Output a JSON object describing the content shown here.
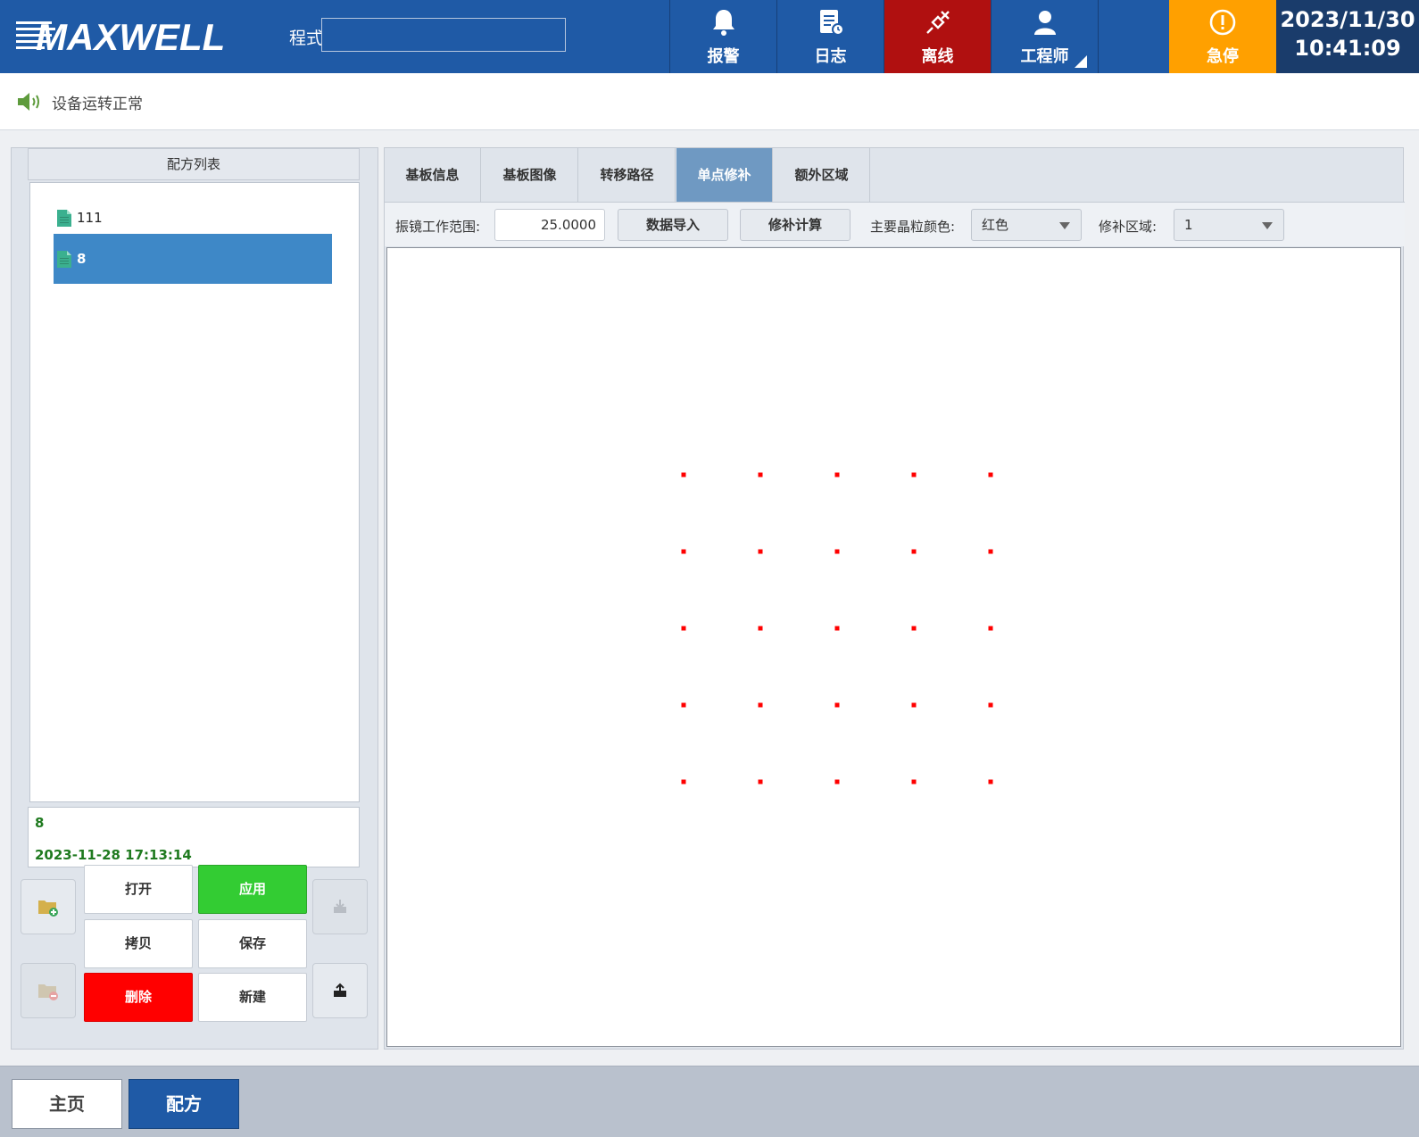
{
  "header": {
    "logo_text": "MAXWELL",
    "program_label": "程式",
    "program_value": "",
    "buttons": [
      {
        "label": "报警",
        "icon": "bell-icon"
      },
      {
        "label": "日志",
        "icon": "log-icon"
      },
      {
        "label": "离线",
        "icon": "plug-icon",
        "color": "#b01010"
      },
      {
        "label": "工程师",
        "icon": "user-icon"
      },
      {
        "label": "急停",
        "icon": "warning-icon",
        "color": "#ffa000"
      }
    ],
    "date": "2023/11/30",
    "time": "10:41:09"
  },
  "status": {
    "text": "设备运转正常",
    "icon": "speaker-icon"
  },
  "recipe_list": {
    "title": "配方列表",
    "items": [
      {
        "label": "111",
        "selected": false
      },
      {
        "label": "8",
        "selected": true
      }
    ],
    "info": {
      "name": "8",
      "timestamp": "2023-11-28 17:13:14"
    },
    "buttons": {
      "open": "打开",
      "apply": "应用",
      "copy": "拷贝",
      "save": "保存",
      "delete": "删除",
      "new": "新建"
    }
  },
  "tabs": [
    {
      "label": "基板信息",
      "active": false
    },
    {
      "label": "基板图像",
      "active": false
    },
    {
      "label": "转移路径",
      "active": false
    },
    {
      "label": "单点修补",
      "active": true
    },
    {
      "label": "额外区域",
      "active": false
    }
  ],
  "toolbar": {
    "range_label": "振镜工作范围:",
    "range_value": "25.0000",
    "import_button": "数据导入",
    "calc_button": "修补计算",
    "color_label": "主要晶粒颜色:",
    "color_value": "红色",
    "region_label": "修补区域:",
    "region_value": "1"
  },
  "grid": {
    "rows": 5,
    "cols": 5,
    "point_color": "#ff0000"
  },
  "bottom_nav": {
    "home": "主页",
    "recipe": "配方"
  },
  "colors": {
    "primary": "#1f5aa6",
    "offline": "#b01010",
    "estop": "#ffa000",
    "apply": "#33cc33",
    "delete": "#ff0000",
    "selected": "#3e88c7",
    "active_tab": "#6f99c2"
  }
}
